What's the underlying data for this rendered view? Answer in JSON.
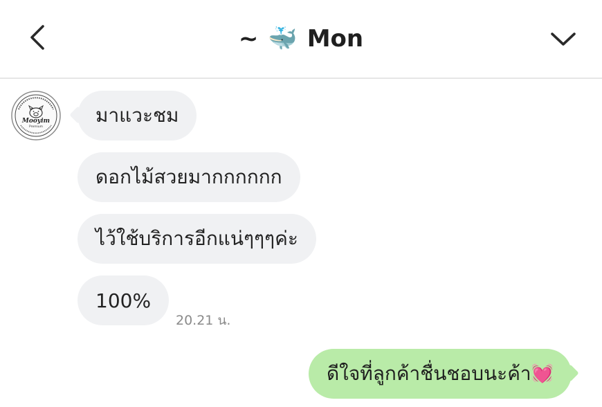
{
  "header": {
    "title_prefix": "~",
    "title_emoji": "🐳",
    "title_name": "Mon"
  },
  "contact": {
    "avatar_text_top": "Thai northern sausage",
    "avatar_brand": "Mooyim",
    "avatar_sub": "Premium",
    "avatar_tel": "Tel. 094-629-6916"
  },
  "messages": [
    {
      "direction": "in",
      "text": "มาแวะชม"
    },
    {
      "direction": "in",
      "text": "ดอกไม้สวยมากกกกกก"
    },
    {
      "direction": "in",
      "text": "ไว้ใช้บริการอีกแน่ๆๆๆค่ะ"
    },
    {
      "direction": "in",
      "text": "100%",
      "time": "20.21 น."
    },
    {
      "direction": "out",
      "text": "ดีใจที่ลูกค้าชื่นชอบนะค้า",
      "emoji": "💓"
    }
  ],
  "colors": {
    "incoming_bubble": "#f0f1f3",
    "outgoing_bubble": "#b9eba8",
    "header_border": "#e6e6e6"
  },
  "icons": {
    "back": "chevron-left-icon",
    "collapse": "chevron-down-icon",
    "reaction": "growing-heart-icon"
  }
}
